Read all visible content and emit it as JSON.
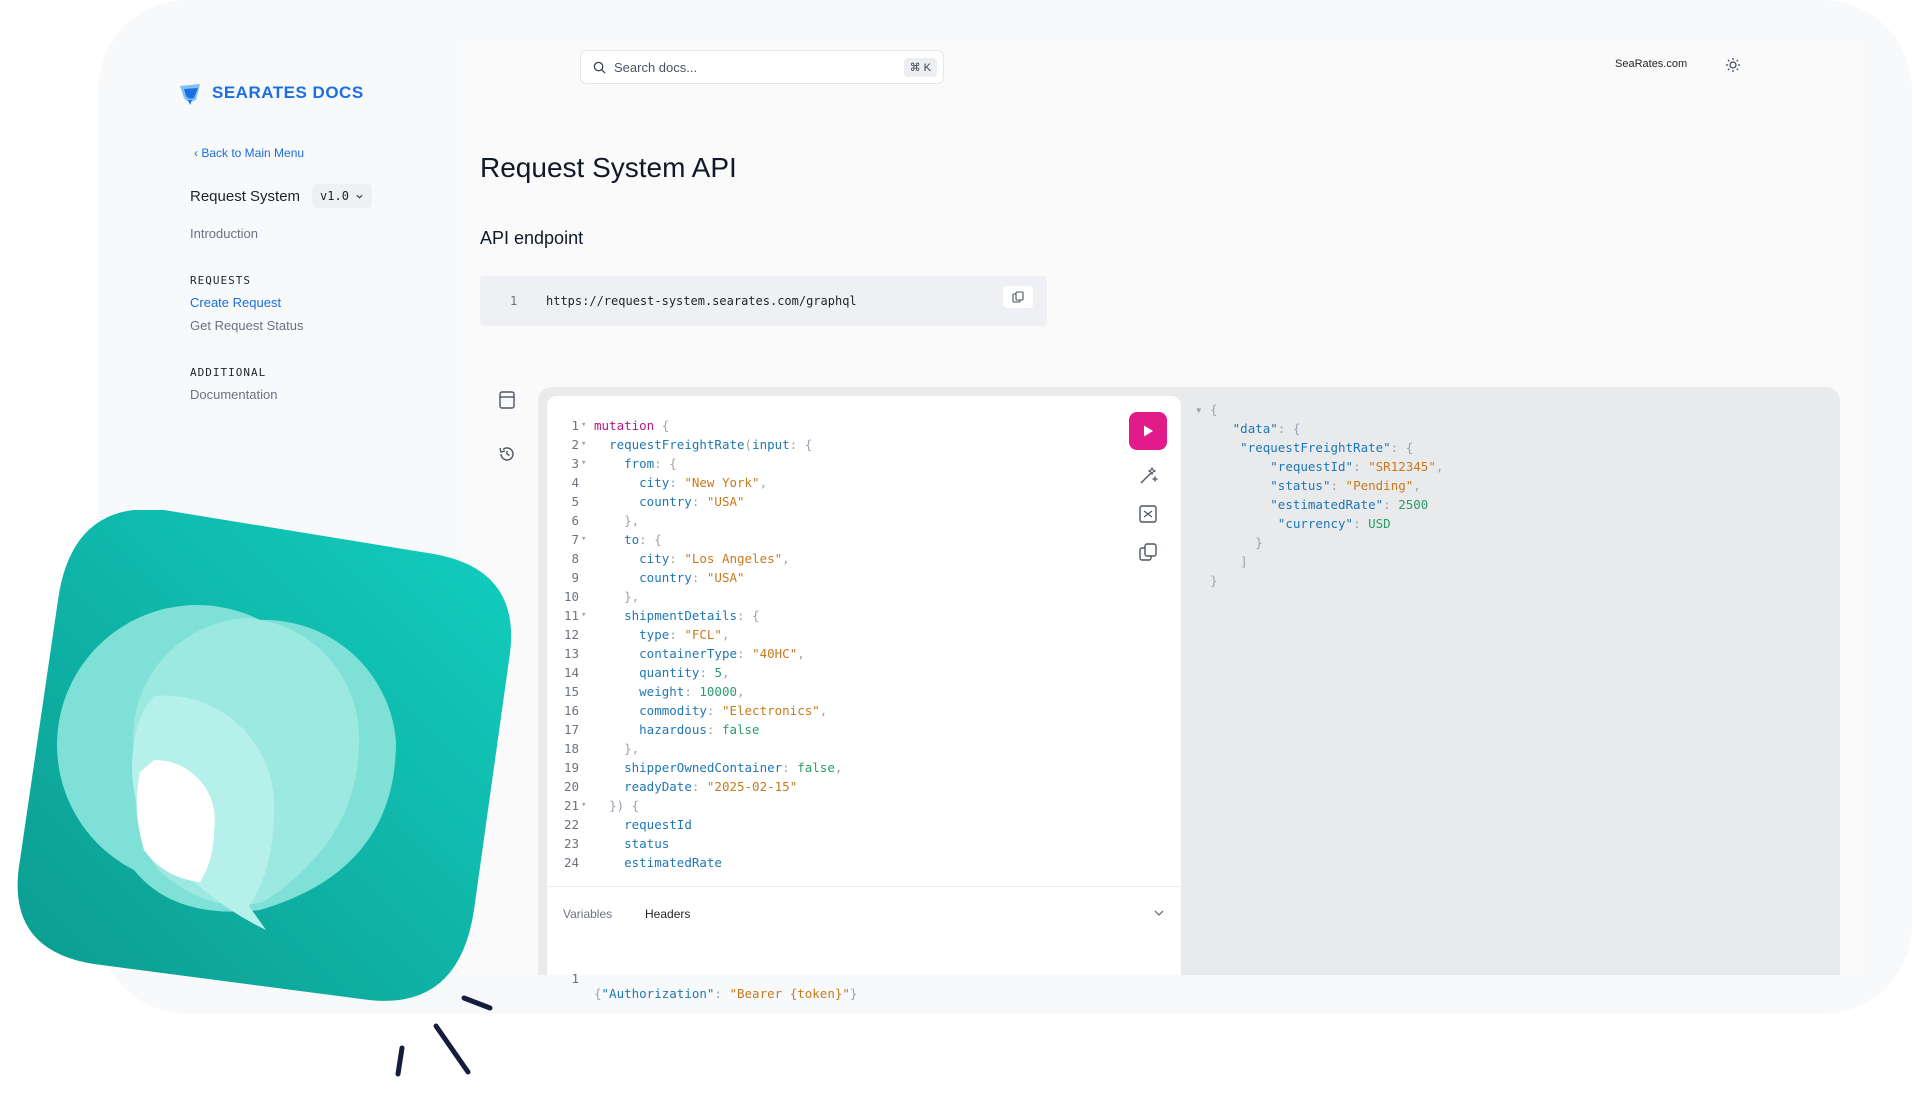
{
  "brand": {
    "name_main": "SEARATES",
    "name_docs": "DOCS"
  },
  "topbar": {
    "search_placeholder": "Search docs...",
    "search_shortcut": "⌘ K",
    "site_link": "SeaRates.com"
  },
  "sidebar": {
    "back_label": "‹ Back to Main Menu",
    "system_name": "Request System",
    "version": "v1.0",
    "intro": "Introduction",
    "requests_heading": "REQUESTS",
    "requests_items": [
      "Create Request",
      "Get Request Status"
    ],
    "additional_heading": "ADDITIONAL",
    "additional_items": [
      "Documentation"
    ]
  },
  "page": {
    "title": "Request System API",
    "section": "API endpoint",
    "endpoint_line": "1",
    "endpoint_url": "https://request-system.searates.com/graphql"
  },
  "editor": {
    "lines": [
      [
        [
          "kw",
          "mutation"
        ],
        [
          "punc",
          " {"
        ]
      ],
      [
        [
          "plain",
          "  "
        ],
        [
          "prop",
          "requestFreightRate"
        ],
        [
          "punc",
          "("
        ],
        [
          "prop",
          "input"
        ],
        [
          "punc",
          ": {"
        ]
      ],
      [
        [
          "plain",
          "    "
        ],
        [
          "prop",
          "from"
        ],
        [
          "punc",
          ": {"
        ]
      ],
      [
        [
          "plain",
          "      "
        ],
        [
          "prop",
          "city"
        ],
        [
          "punc",
          ": "
        ],
        [
          "str",
          "\"New York\""
        ],
        [
          "punc",
          ","
        ]
      ],
      [
        [
          "plain",
          "      "
        ],
        [
          "prop",
          "country"
        ],
        [
          "punc",
          ": "
        ],
        [
          "str",
          "\"USA\""
        ]
      ],
      [
        [
          "plain",
          "    "
        ],
        [
          "punc",
          "},"
        ]
      ],
      [
        [
          "plain",
          "    "
        ],
        [
          "prop",
          "to"
        ],
        [
          "punc",
          ": {"
        ]
      ],
      [
        [
          "plain",
          "      "
        ],
        [
          "prop",
          "city"
        ],
        [
          "punc",
          ": "
        ],
        [
          "str",
          "\"Los Angeles\""
        ],
        [
          "punc",
          ","
        ]
      ],
      [
        [
          "plain",
          "      "
        ],
        [
          "prop",
          "country"
        ],
        [
          "punc",
          ": "
        ],
        [
          "str",
          "\"USA\""
        ]
      ],
      [
        [
          "plain",
          "    "
        ],
        [
          "punc",
          "},"
        ]
      ],
      [
        [
          "plain",
          "    "
        ],
        [
          "prop",
          "shipmentDetails"
        ],
        [
          "punc",
          ": {"
        ]
      ],
      [
        [
          "plain",
          "      "
        ],
        [
          "prop",
          "type"
        ],
        [
          "punc",
          ": "
        ],
        [
          "str",
          "\"FCL\""
        ],
        [
          "punc",
          ","
        ]
      ],
      [
        [
          "plain",
          "      "
        ],
        [
          "prop",
          "containerType"
        ],
        [
          "punc",
          ": "
        ],
        [
          "str",
          "\"40HC\""
        ],
        [
          "punc",
          ","
        ]
      ],
      [
        [
          "plain",
          "      "
        ],
        [
          "prop",
          "quantity"
        ],
        [
          "punc",
          ": "
        ],
        [
          "num",
          "5"
        ],
        [
          "punc",
          ","
        ]
      ],
      [
        [
          "plain",
          "      "
        ],
        [
          "prop",
          "weight"
        ],
        [
          "punc",
          ": "
        ],
        [
          "num",
          "10000"
        ],
        [
          "punc",
          ","
        ]
      ],
      [
        [
          "plain",
          "      "
        ],
        [
          "prop",
          "commodity"
        ],
        [
          "punc",
          ": "
        ],
        [
          "str",
          "\"Electronics\""
        ],
        [
          "punc",
          ","
        ]
      ],
      [
        [
          "plain",
          "      "
        ],
        [
          "prop",
          "hazardous"
        ],
        [
          "punc",
          ": "
        ],
        [
          "num",
          "false"
        ]
      ],
      [
        [
          "plain",
          "    "
        ],
        [
          "punc",
          "},"
        ]
      ],
      [
        [
          "plain",
          "    "
        ],
        [
          "prop",
          "shipperOwnedContainer"
        ],
        [
          "punc",
          ": "
        ],
        [
          "num",
          "false"
        ],
        [
          "punc",
          ","
        ]
      ],
      [
        [
          "plain",
          "    "
        ],
        [
          "prop",
          "readyDate"
        ],
        [
          "punc",
          ": "
        ],
        [
          "str",
          "\"2025-02-15\""
        ]
      ],
      [
        [
          "plain",
          "  "
        ],
        [
          "punc",
          "}) {"
        ]
      ],
      [
        [
          "plain",
          "    "
        ],
        [
          "prop",
          "requestId"
        ]
      ],
      [
        [
          "plain",
          "    "
        ],
        [
          "prop",
          "status"
        ]
      ],
      [
        [
          "plain",
          "    "
        ],
        [
          "prop",
          "estimatedRate"
        ]
      ]
    ],
    "fold_lines": [
      1,
      2,
      3,
      7,
      11,
      21
    ],
    "tab_variables": "Variables",
    "tab_headers": "Headers",
    "headers_line_no": "1",
    "headers_tokens": [
      [
        "punc",
        "{"
      ],
      [
        "prop",
        "\"Authorization\""
      ],
      [
        "punc",
        ": "
      ],
      [
        "str",
        "\"Bearer {token}\""
      ],
      [
        "punc",
        "}"
      ]
    ]
  },
  "response": {
    "lines": [
      [
        [
          "punc",
          "▾ {"
        ]
      ],
      [
        [
          "plain",
          "     "
        ],
        [
          "key",
          "\"data\""
        ],
        [
          "punc",
          ": {"
        ]
      ],
      [
        [
          "plain",
          "      "
        ],
        [
          "key",
          "\"requestFreightRate\""
        ],
        [
          "punc",
          ": {"
        ]
      ],
      [
        [
          "plain",
          "          "
        ],
        [
          "key",
          "\"requestId\""
        ],
        [
          "punc",
          ": "
        ],
        [
          "str",
          "\"SR12345\""
        ],
        [
          "punc",
          ","
        ]
      ],
      [
        [
          "plain",
          "          "
        ],
        [
          "key",
          "\"status\""
        ],
        [
          "punc",
          ": "
        ],
        [
          "str",
          "\"Pending\""
        ],
        [
          "punc",
          ","
        ]
      ],
      [
        [
          "plain",
          "          "
        ],
        [
          "key",
          "\"estimatedRate\""
        ],
        [
          "punc",
          ": "
        ],
        [
          "num",
          "2500"
        ]
      ],
      [
        [
          "plain",
          "           "
        ],
        [
          "key",
          "\"currency\""
        ],
        [
          "punc",
          ": "
        ],
        [
          "num",
          "USD"
        ]
      ],
      [
        [
          "plain",
          "        "
        ],
        [
          "punc",
          "}"
        ]
      ],
      [
        [
          "plain",
          "      "
        ],
        [
          "punc",
          "]"
        ]
      ],
      [
        [
          "plain",
          "  "
        ],
        [
          "punc",
          "}"
        ]
      ]
    ]
  },
  "colors": {
    "accent": "#1c6fe0",
    "run_button": "#e11b8a",
    "badge": "#10c2b0",
    "sparks": "#141d3b"
  }
}
